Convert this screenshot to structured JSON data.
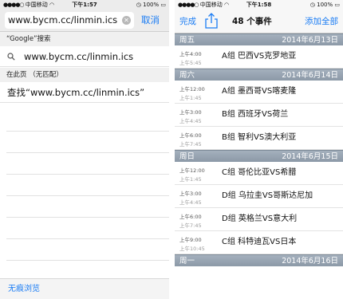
{
  "left": {
    "status": {
      "carrier": "中国移动",
      "signal": "●●●●○",
      "time": "下午1:57",
      "battery": "100%"
    },
    "address": {
      "url": "www.bycm.cc/linmin.ics",
      "clear_glyph": "✕",
      "cancel_label": "取消"
    },
    "google_header": "“Google”搜索",
    "google_suggestion": "www.bycm.cc/linmin.ics",
    "on_page_header": "在此页 （无匹配）",
    "find_suggestion": "查找“www.bycm.cc/linmin.ics”",
    "private_browsing_label": "无痕浏览"
  },
  "right": {
    "status": {
      "carrier": "中国移动",
      "signal": "●●●●○",
      "time": "下午1:58",
      "battery": "100%"
    },
    "nav": {
      "done_label": "完成",
      "title": "48 个事件",
      "add_all_label": "添加全部"
    },
    "days": [
      {
        "weekday": "周五",
        "date": "2014年6月13日",
        "events": [
          {
            "start": "上午4:00",
            "end": "上午5:45",
            "title": "A组 巴西VS克罗地亚"
          }
        ]
      },
      {
        "weekday": "周六",
        "date": "2014年6月14日",
        "events": [
          {
            "start": "上午12:00",
            "end": "上午1:45",
            "title": "A组 墨西哥VS喀麦隆"
          },
          {
            "start": "上午3:00",
            "end": "上午4:45",
            "title": "B组 西班牙VS荷兰"
          },
          {
            "start": "上午6:00",
            "end": "上午7:45",
            "title": "B组 智利VS澳大利亚"
          }
        ]
      },
      {
        "weekday": "周日",
        "date": "2014年6月15日",
        "events": [
          {
            "start": "上午12:00",
            "end": "上午1:45",
            "title": "C组 哥伦比亚VS希腊"
          },
          {
            "start": "上午3:00",
            "end": "上午4:45",
            "title": "D组 乌拉圭VS哥斯达尼加"
          },
          {
            "start": "上午6:00",
            "end": "上午7:45",
            "title": "D组 英格兰VS意大利"
          },
          {
            "start": "上午9:00",
            "end": "上午10:45",
            "title": "C组 科特迪瓦VS日本"
          }
        ]
      },
      {
        "weekday": "周一",
        "date": "2014年6月16日",
        "events": []
      }
    ]
  },
  "colors": {
    "accent": "#1a7cf4",
    "day_header": "#98a4b1"
  },
  "icons": {
    "search": "magnifier-icon",
    "share": "share-icon",
    "wifi": "wifi-icon",
    "alarm": "alarm-icon"
  }
}
